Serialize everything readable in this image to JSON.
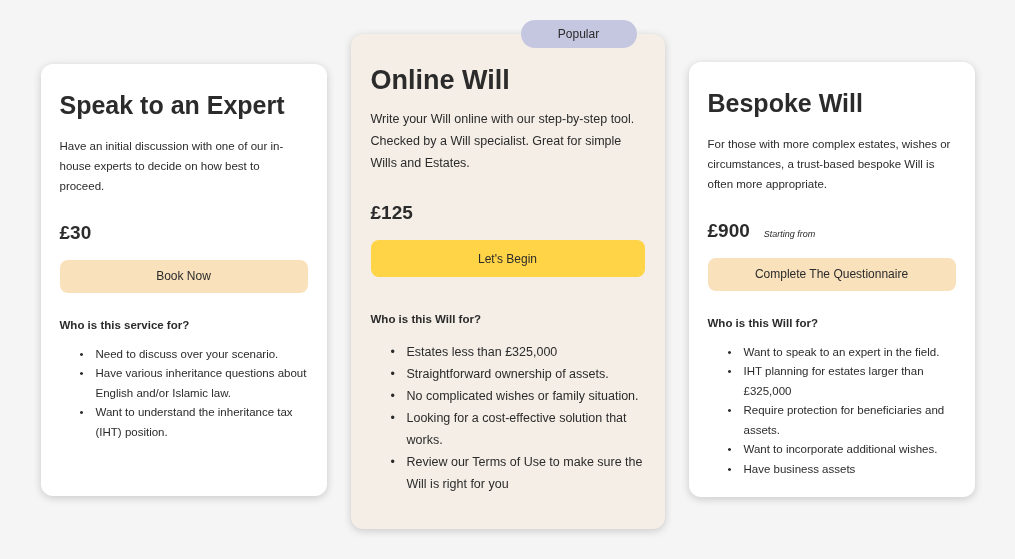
{
  "plans": [
    {
      "kind": "standard",
      "title": "Speak to an Expert",
      "description": "Have an initial discussion with one of our in-house experts to decide on how best to proceed.",
      "price": "£30",
      "button": "Book Now",
      "audience_heading": "Who is this service for?",
      "points": [
        {
          "bullet": "•",
          "text": "Need to discuss over your scenario."
        },
        {
          "bullet": "•",
          "text": "Have various inheritance questions about English and/or Islamic law."
        },
        {
          "bullet": "•",
          "text": "Want to understand the inheritance tax (IHT) position."
        }
      ]
    },
    {
      "kind": "featured",
      "badge": "Popular",
      "title": "Online Will",
      "description": "Write your Will online with our step-by-step tool. Checked by a Will specialist. Great for simple Wills and Estates.",
      "price": "£125",
      "button": "Let's Begin",
      "audience_heading": "Who is this Will for?",
      "points": [
        {
          "bullet": "•",
          "text": "Estates less than £325,000"
        },
        {
          "bullet": "•",
          "text": "Straightforward ownership of assets."
        },
        {
          "bullet": "•",
          "text": "No complicated wishes or family situation."
        },
        {
          "bullet": "•",
          "text": "Looking for a cost-effective solution that works."
        },
        {
          "bullet": "•",
          "text": "Review our Terms of Use to make sure the Will is right for you"
        }
      ]
    },
    {
      "kind": "standard",
      "title": "Bespoke Will",
      "description": "For those with more complex estates, wishes or circumstances, a trust-based bespoke Will is often more appropriate.",
      "price": "£900",
      "price_note": "Starting from",
      "button": "Complete The Questionnaire",
      "audience_heading": "Who is this Will for?",
      "points": [
        {
          "bullet": "•",
          "text": "Want to speak to an expert in the field."
        },
        {
          "bullet": "•",
          "text": "IHT planning for estates larger than £325,000"
        },
        {
          "bullet": "•",
          "text": "Require protection for beneficiaries and assets."
        },
        {
          "bullet": "•",
          "text": "Want to incorporate additional wishes."
        },
        {
          "bullet": "•",
          "text": "Have business assets"
        }
      ]
    }
  ]
}
